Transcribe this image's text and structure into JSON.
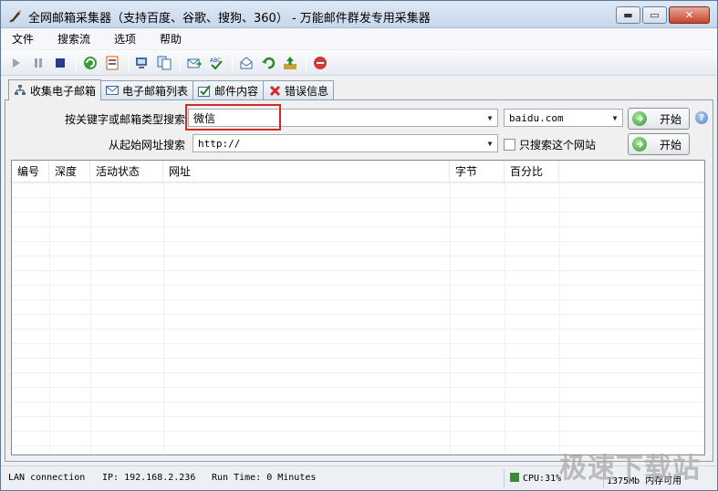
{
  "window": {
    "title": "全网邮箱采集器（支持百度、谷歌、搜狗、360） - 万能邮件群发专用采集器",
    "minimize_glyph": "▬",
    "maximize_glyph": "▭",
    "close_glyph": "✕"
  },
  "menu": [
    "文件",
    "搜索流",
    "选项",
    "帮助"
  ],
  "tabs": [
    {
      "label": "收集电子邮箱",
      "icon": "network-icon"
    },
    {
      "label": "电子邮箱列表",
      "icon": "envelope-icon"
    },
    {
      "label": "邮件内容",
      "icon": "checkbox-mail-icon"
    },
    {
      "label": "错误信息",
      "icon": "red-x-icon"
    }
  ],
  "search": {
    "keyword_label": "按关键字或邮箱类型搜索",
    "keyword_value": "微信",
    "engine_value": "baidu.com",
    "start_button": "开始",
    "url_label": "从起始网址搜索",
    "url_value": "http://",
    "only_site_label": "只搜索这个网站",
    "start_button_2": "开始",
    "help_glyph": "?"
  },
  "table": {
    "columns": [
      "编号",
      "深度",
      "活动状态",
      "网址",
      "字节",
      "百分比"
    ],
    "rows": []
  },
  "status": {
    "connection": "LAN connection",
    "ip": "IP: 192.168.2.236",
    "runtime": "Run Time: 0 Minutes",
    "cpu": "CPU:31%",
    "memory": "1375Mb 内存可用"
  },
  "watermark": "极速下载站",
  "colors": {
    "highlight": "#d32a2a",
    "go_button": "#2f9a2f"
  }
}
